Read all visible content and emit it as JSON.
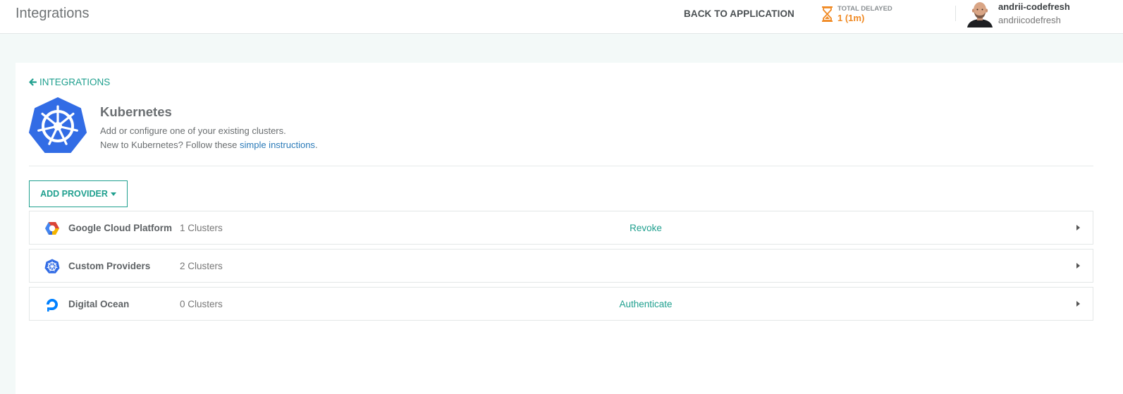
{
  "header": {
    "title": "Integrations",
    "back_label": "BACK TO APPLICATION",
    "delayed_label": "TOTAL DELAYED",
    "delayed_value": "1 (1m)",
    "user_name": "andrii-codefresh",
    "user_login": "andriicodefresh"
  },
  "crumb": {
    "label": "INTEGRATIONS"
  },
  "integration": {
    "title": "Kubernetes",
    "description": "Add or configure one of your existing clusters.",
    "help_prefix": "New to Kubernetes? Follow these ",
    "help_link": "simple instructions",
    "help_suffix": "."
  },
  "add_provider": {
    "label": "ADD PROVIDER"
  },
  "providers": [
    {
      "name": "Google Cloud Platform",
      "clusters": "1 Clusters",
      "action": "Revoke",
      "icon": "gcp-icon"
    },
    {
      "name": "Custom Providers",
      "clusters": "2 Clusters",
      "action": "",
      "icon": "kubernetes-icon"
    },
    {
      "name": "Digital Ocean",
      "clusters": "0 Clusters",
      "action": "Authenticate",
      "icon": "digital-ocean-icon"
    }
  ],
  "colors": {
    "accent": "#20a08f",
    "warning": "#f08a24",
    "kube_blue": "#326ce5",
    "link": "#2a7ab8"
  }
}
